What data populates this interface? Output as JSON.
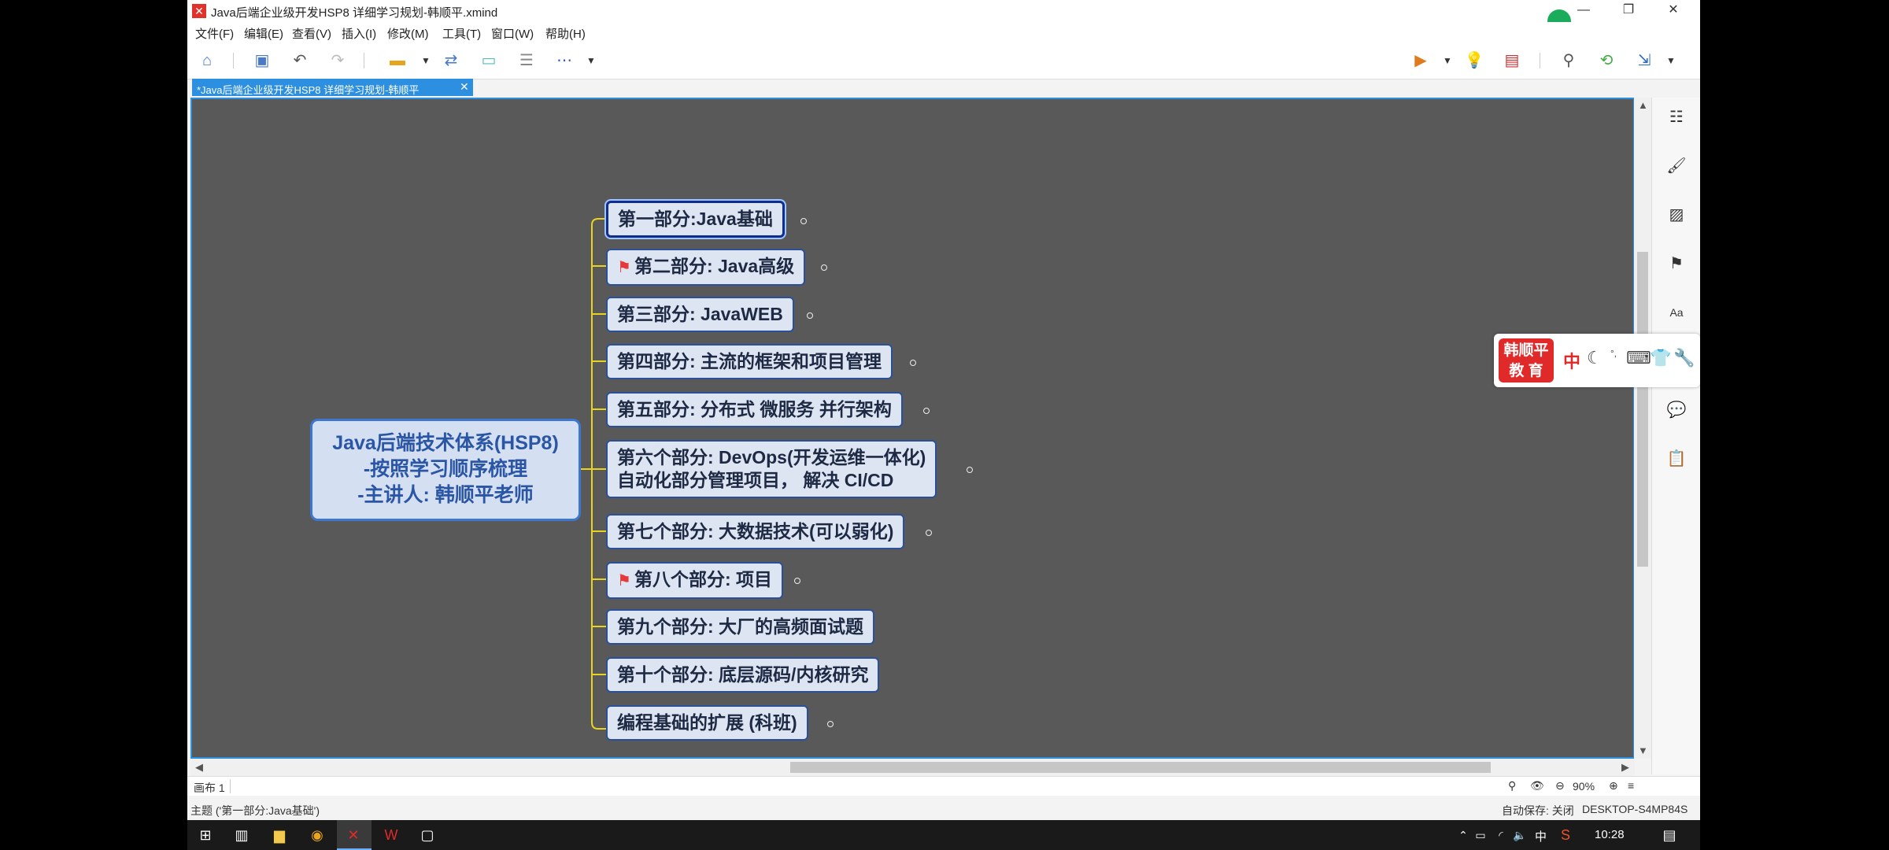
{
  "window": {
    "title": "Java后端企业级开发HSP8 详细学习规划-韩顺平.xmind",
    "minimize": "—",
    "maximize": "❐",
    "close": "✕"
  },
  "menu": [
    "文件(F)",
    "编辑(E)",
    "查看(V)",
    "插入(I)",
    "修改(M)",
    "工具(T)",
    "窗口(W)",
    "帮助(H)"
  ],
  "tab": {
    "label": "*Java后端企业级开发HSP8 详细学习规划-韩顺平",
    "close": "✕"
  },
  "mindmap": {
    "central": [
      "Java后端技术体系(HSP8)",
      "-按照学习顺序梳理",
      "-主讲人: 韩顺平老师"
    ],
    "topics": [
      {
        "text": "第一部分:Java基础",
        "selected": true,
        "flag": false
      },
      {
        "text": "第二部分: Java高级",
        "flag": true
      },
      {
        "text": "第三部分: JavaWEB",
        "flag": false
      },
      {
        "text": "第四部分: 主流的框架和项目管理",
        "flag": false
      },
      {
        "text": "第五部分: 分布式 微服务 并行架构",
        "flag": false
      },
      {
        "text": "第六个部分: DevOps(开发运维一体化)",
        "text2": "自动化部分管理项目， 解决 CI/CD",
        "flag": false
      },
      {
        "text": "第七个部分: 大数据技术(可以弱化)",
        "flag": false
      },
      {
        "text": "第八个部分: 项目",
        "flag": true
      },
      {
        "text": "第九个部分: 大厂的高频面试题",
        "flag": false
      },
      {
        "text": "第十个部分: 底层源码/内核研究",
        "flag": false
      },
      {
        "text": "编程基础的扩展 (科班)",
        "flag": false
      }
    ],
    "connector_color": "#e8d320"
  },
  "ime": {
    "logo_line1": "韩顺平",
    "logo_line2": "教  育",
    "mode": "中"
  },
  "canvas_status": {
    "sheet": "画布 1",
    "zoom": "90%"
  },
  "status": {
    "selection": "主题 ('第一部分:Java基础')",
    "autosave": "自动保存: 关闭",
    "machine": "DESKTOP-S4MP84S"
  },
  "taskbar": {
    "time": "10:28",
    "ime": "中"
  }
}
